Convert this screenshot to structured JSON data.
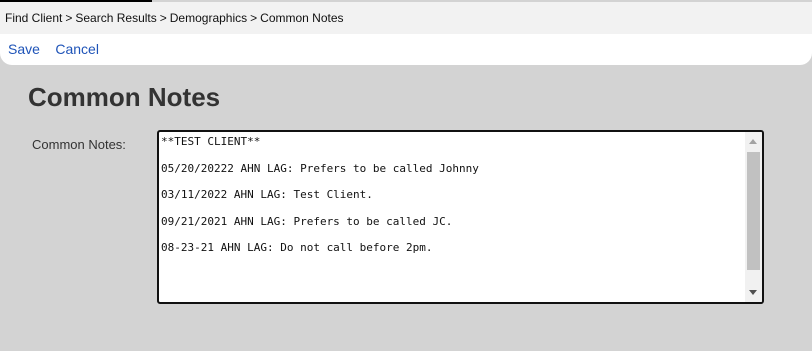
{
  "breadcrumb": {
    "items": [
      "Find Client",
      "Search Results",
      "Demographics",
      "Common Notes"
    ],
    "separator": ">"
  },
  "toolbar": {
    "save_label": "Save",
    "cancel_label": "Cancel"
  },
  "page": {
    "title": "Common Notes"
  },
  "form": {
    "common_notes_label": "Common Notes:",
    "notes_lines": [
      "**TEST CLIENT**",
      "05/20/20222 AHN LAG: Prefers to be called Johnny",
      "03/11/2022 AHN LAG: Test Client.",
      "09/21/2021 AHN LAG: Prefers to be called JC.",
      "08-23-21 AHN LAG: Do not call before 2pm."
    ]
  },
  "colors": {
    "background": "#d3d3d3",
    "link": "#1f54b8",
    "title": "#333333"
  }
}
